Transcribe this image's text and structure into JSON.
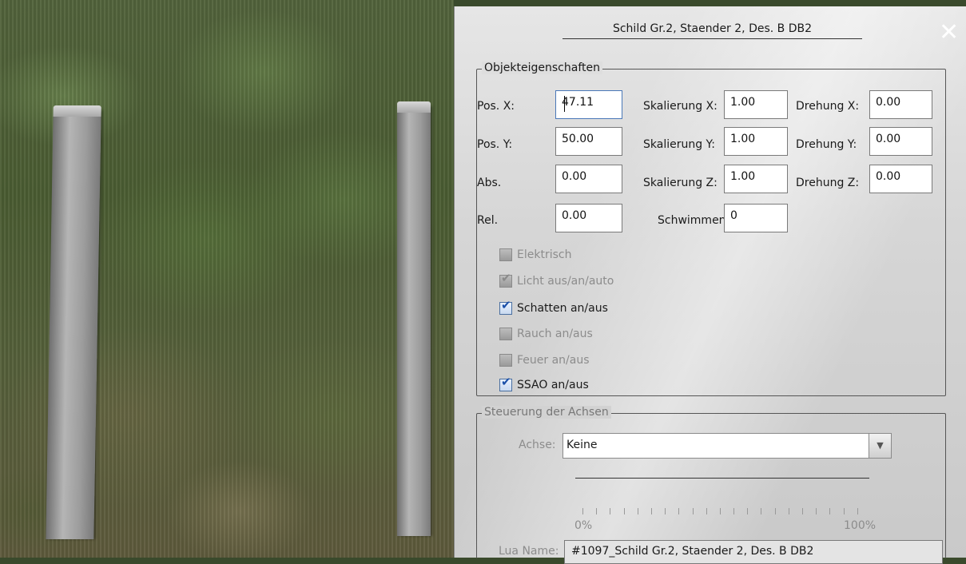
{
  "dialog": {
    "title": "Schild Gr.2, Staender 2, Des. B DB2",
    "close_glyph": "✕"
  },
  "properties": {
    "legend": "Objekteigenschaften",
    "pos_x": {
      "label": "Pos. X:",
      "value": "47.11"
    },
    "pos_y": {
      "label": "Pos. Y:",
      "value": "50.00"
    },
    "abs": {
      "label": "Abs.",
      "value": "0.00"
    },
    "rel": {
      "label": "Rel.",
      "value": "0.00"
    },
    "scale_x": {
      "label": "Skalierung X:",
      "value": "1.00"
    },
    "scale_y": {
      "label": "Skalierung Y:",
      "value": "1.00"
    },
    "scale_z": {
      "label": "Skalierung Z:",
      "value": "1.00"
    },
    "swim": {
      "label": "Schwimmen:",
      "value": "0"
    },
    "rot_x": {
      "label": "Drehung X:",
      "value": "0.00"
    },
    "rot_y": {
      "label": "Drehung Y:",
      "value": "0.00"
    },
    "rot_z": {
      "label": "Drehung Z:",
      "value": "0.00"
    },
    "checkboxes": [
      {
        "label": "Elektrisch",
        "checked": false,
        "enabled": false
      },
      {
        "label": "Licht aus/an/auto",
        "checked": true,
        "enabled": false
      },
      {
        "label": "Schatten an/aus",
        "checked": true,
        "enabled": true
      },
      {
        "label": "Rauch an/aus",
        "checked": false,
        "enabled": false
      },
      {
        "label": "Feuer an/aus",
        "checked": false,
        "enabled": false
      },
      {
        "label": "SSAO an/aus",
        "checked": true,
        "enabled": true
      }
    ]
  },
  "axes": {
    "legend": "Steuerung der Achsen",
    "axis_label": "Achse:",
    "axis_value": "Keine",
    "slider_min": "0%",
    "slider_max": "100%"
  },
  "lua": {
    "label": "Lua Name:",
    "value": "#1097_Schild Gr.2, Staender 2, Des. B DB2"
  },
  "colors": {
    "check_accent": "#1a4fa8",
    "disabled_text": "#8c8c8c"
  }
}
